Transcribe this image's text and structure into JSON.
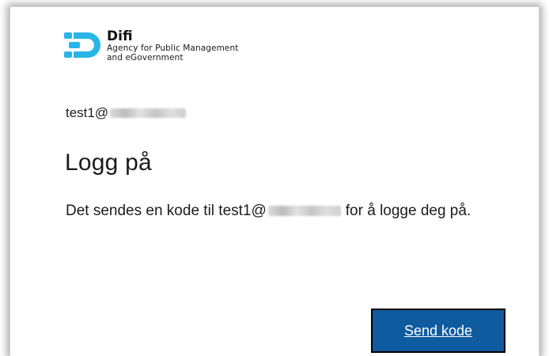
{
  "brand": {
    "name": "Difi",
    "subtitle_line1": "Agency for Public Management",
    "subtitle_line2": "and eGovernment",
    "logo_icon": "difi-logo-icon",
    "colors": {
      "logo_cyan": "#29b5e8"
    }
  },
  "identity": {
    "email_prefix": "test1@"
  },
  "page": {
    "title": "Logg på"
  },
  "message": {
    "before": "Det sendes en kode til test1@",
    "after": "for å logge deg på."
  },
  "actions": {
    "send_code_label": "Send kode",
    "colors": {
      "primary_bg": "#0f5ba0",
      "primary_text": "#ffffff"
    }
  }
}
